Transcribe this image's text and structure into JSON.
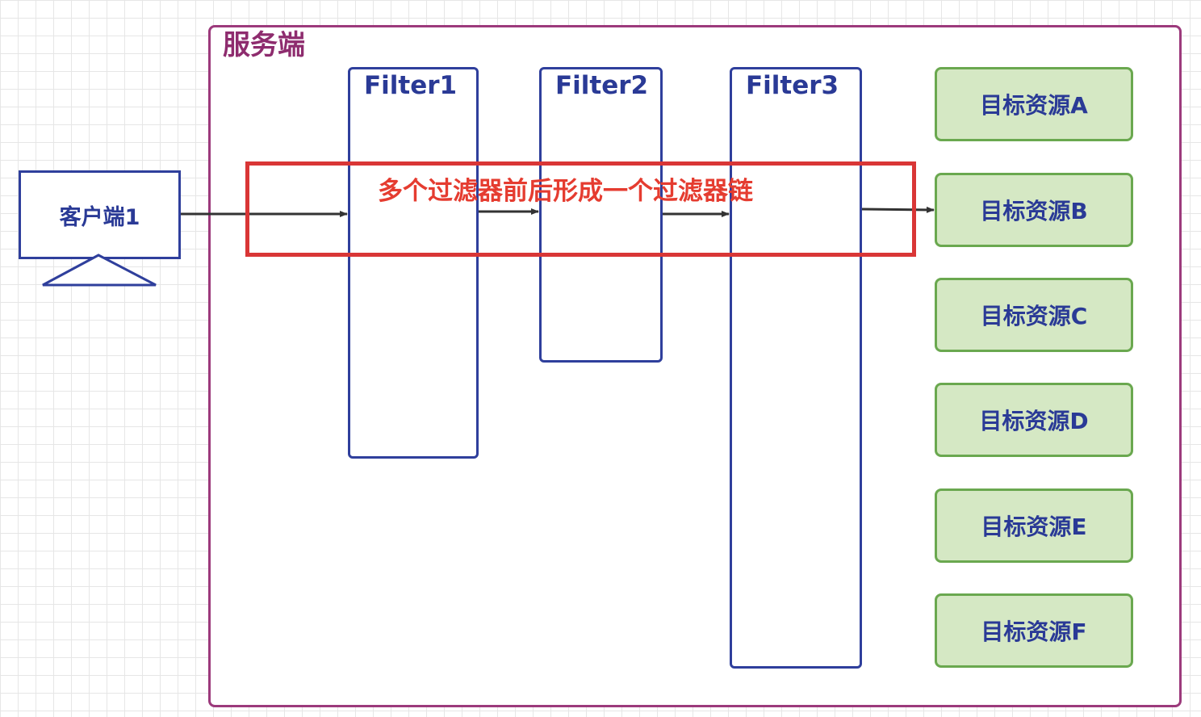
{
  "server": {
    "label": "服务端"
  },
  "client": {
    "label": "客户端1"
  },
  "filters": [
    {
      "label": "Filter1"
    },
    {
      "label": "Filter2"
    },
    {
      "label": "Filter3"
    }
  ],
  "resources": [
    {
      "label": "目标资源A"
    },
    {
      "label": "目标资源B"
    },
    {
      "label": "目标资源C"
    },
    {
      "label": "目标资源D"
    },
    {
      "label": "目标资源E"
    },
    {
      "label": "目标资源F"
    }
  ],
  "chain_note": {
    "label": "多个过滤器前后形成一个过滤器链"
  },
  "colors": {
    "server_border": "#9c3a7c",
    "server_text": "#8e2c6e",
    "filter_border": "#2f3f9c",
    "node_text": "#2a3a96",
    "resource_fill": "#d5e8c4",
    "resource_border": "#6aa84f",
    "highlight": "#d93636",
    "highlight_text": "#e53c30",
    "arrow": "#333333"
  }
}
